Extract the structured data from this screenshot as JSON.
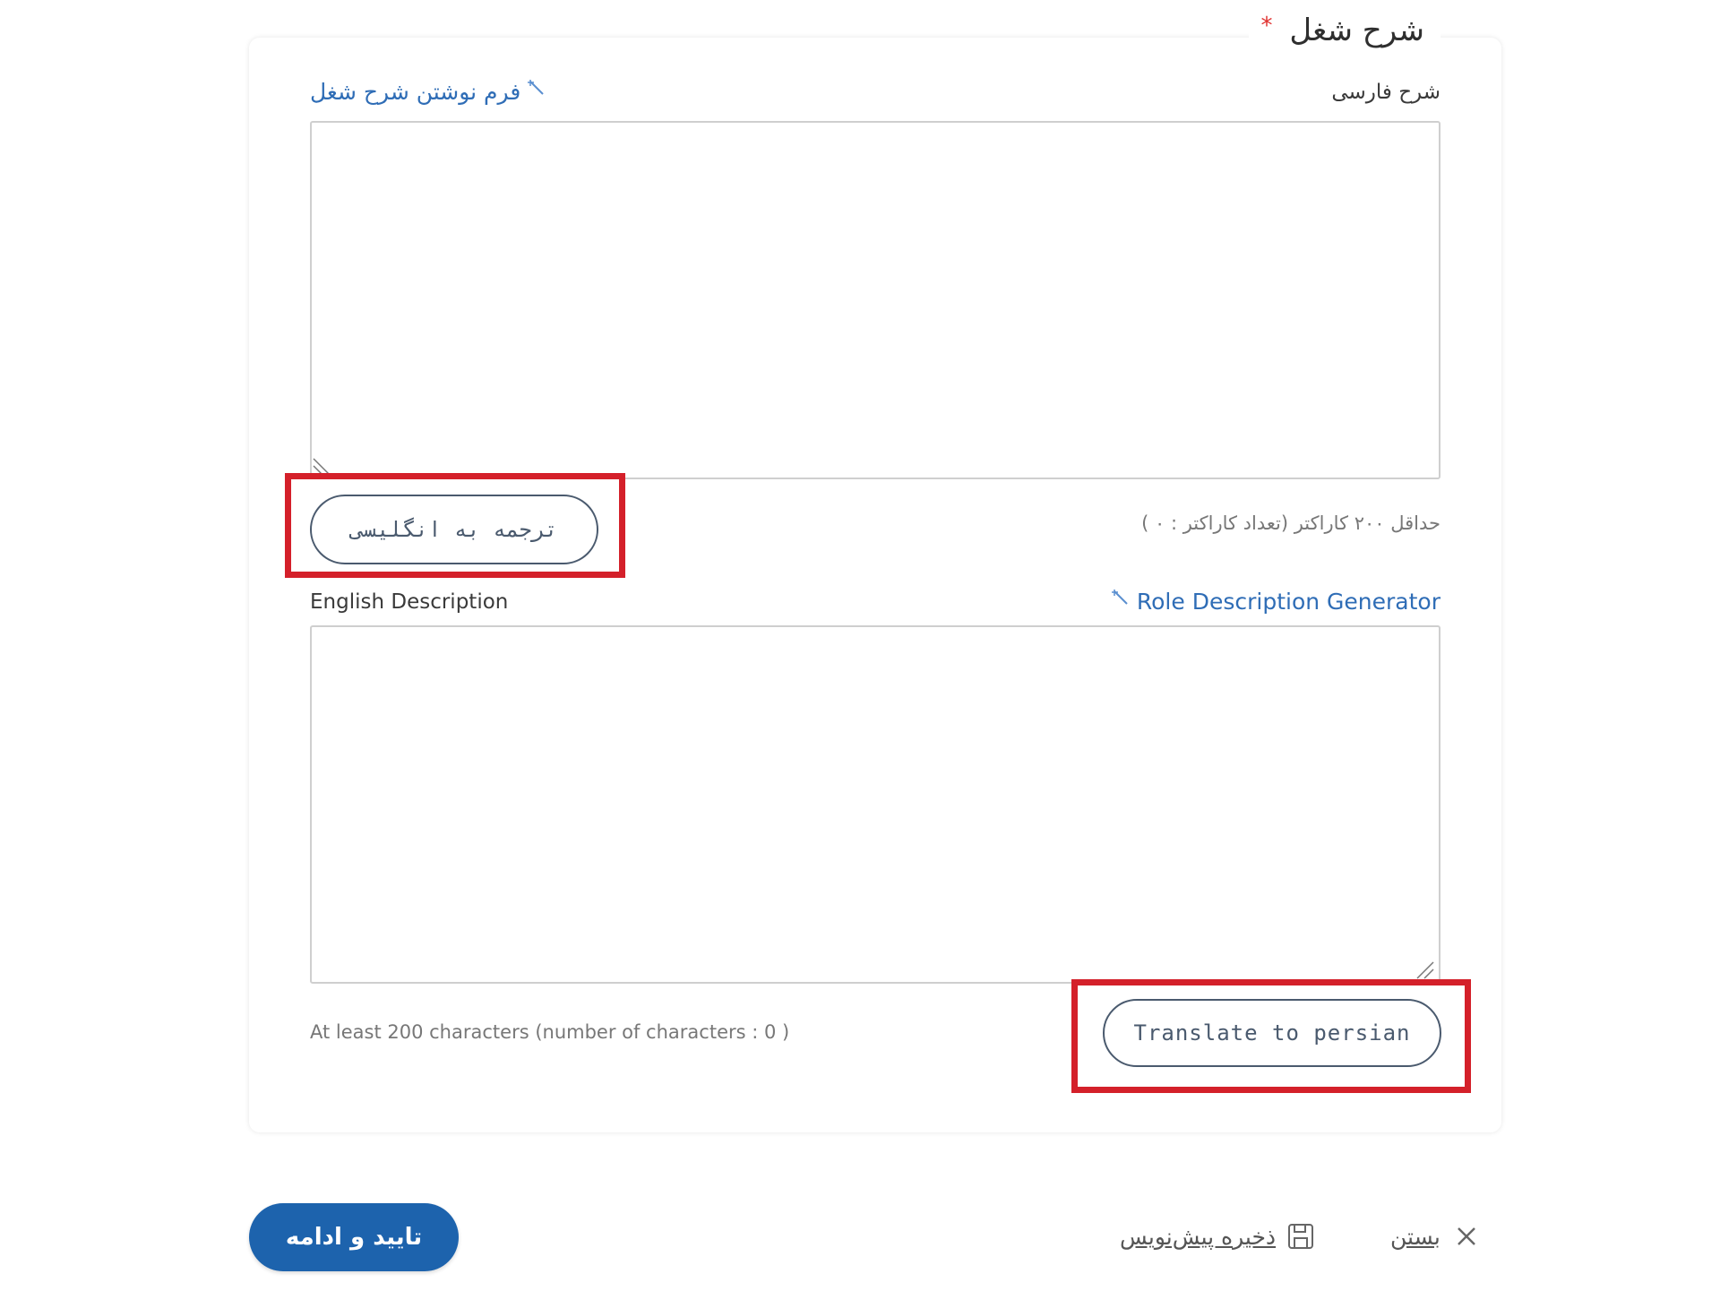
{
  "section": {
    "title": "شرح شغل",
    "required_marker": "*"
  },
  "persian": {
    "label": "شرح فارسی",
    "form_link": "فرم نوشتن شرح شغل",
    "textarea_value": "",
    "hint": "حداقل ۲۰۰ کاراکتر (تعداد کاراکتر : ۰ )",
    "translate_button": "ترجمه به انگلیسی"
  },
  "english": {
    "label": "English Description",
    "generator_link": "Role Description Generator",
    "textarea_value": "",
    "hint": "At least 200 characters (number of characters : 0 )",
    "translate_button": "Translate to persian"
  },
  "footer": {
    "confirm_button": "تایید و ادامه",
    "save_draft": "ذخیره پیش‌نویس",
    "close": "بستن"
  },
  "colors": {
    "accent_blue": "#1d63ad",
    "link_blue": "#2f6db6",
    "highlight_red": "#d4202a",
    "required_red": "#e0312f"
  },
  "icons": {
    "wand": "magic-wand-icon",
    "save": "floppy-disk-icon",
    "close": "close-x-icon",
    "resize": "resize-grip-icon"
  }
}
